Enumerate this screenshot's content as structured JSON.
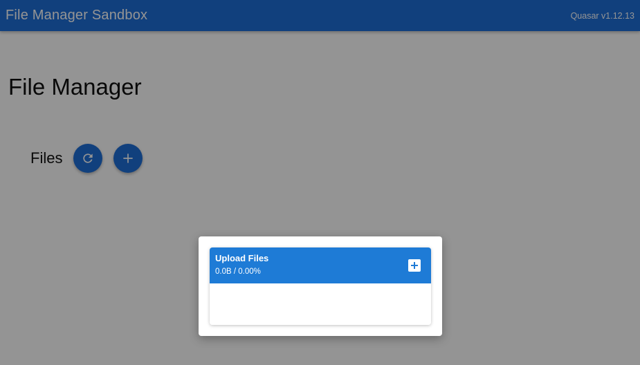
{
  "header": {
    "title": "File Manager Sandbox",
    "version": "Quasar v1.12.13"
  },
  "main": {
    "title": "File Manager",
    "files_label": "Files",
    "refresh_icon": "refresh-icon",
    "add_icon": "plus-icon"
  },
  "dialog": {
    "uploader": {
      "title": "Upload Files",
      "status": "0.0B / 0.00%",
      "add_icon": "add-box-icon"
    }
  },
  "colors": {
    "primary": "#1e6ed8",
    "uploader_header": "#1e7bd6"
  }
}
